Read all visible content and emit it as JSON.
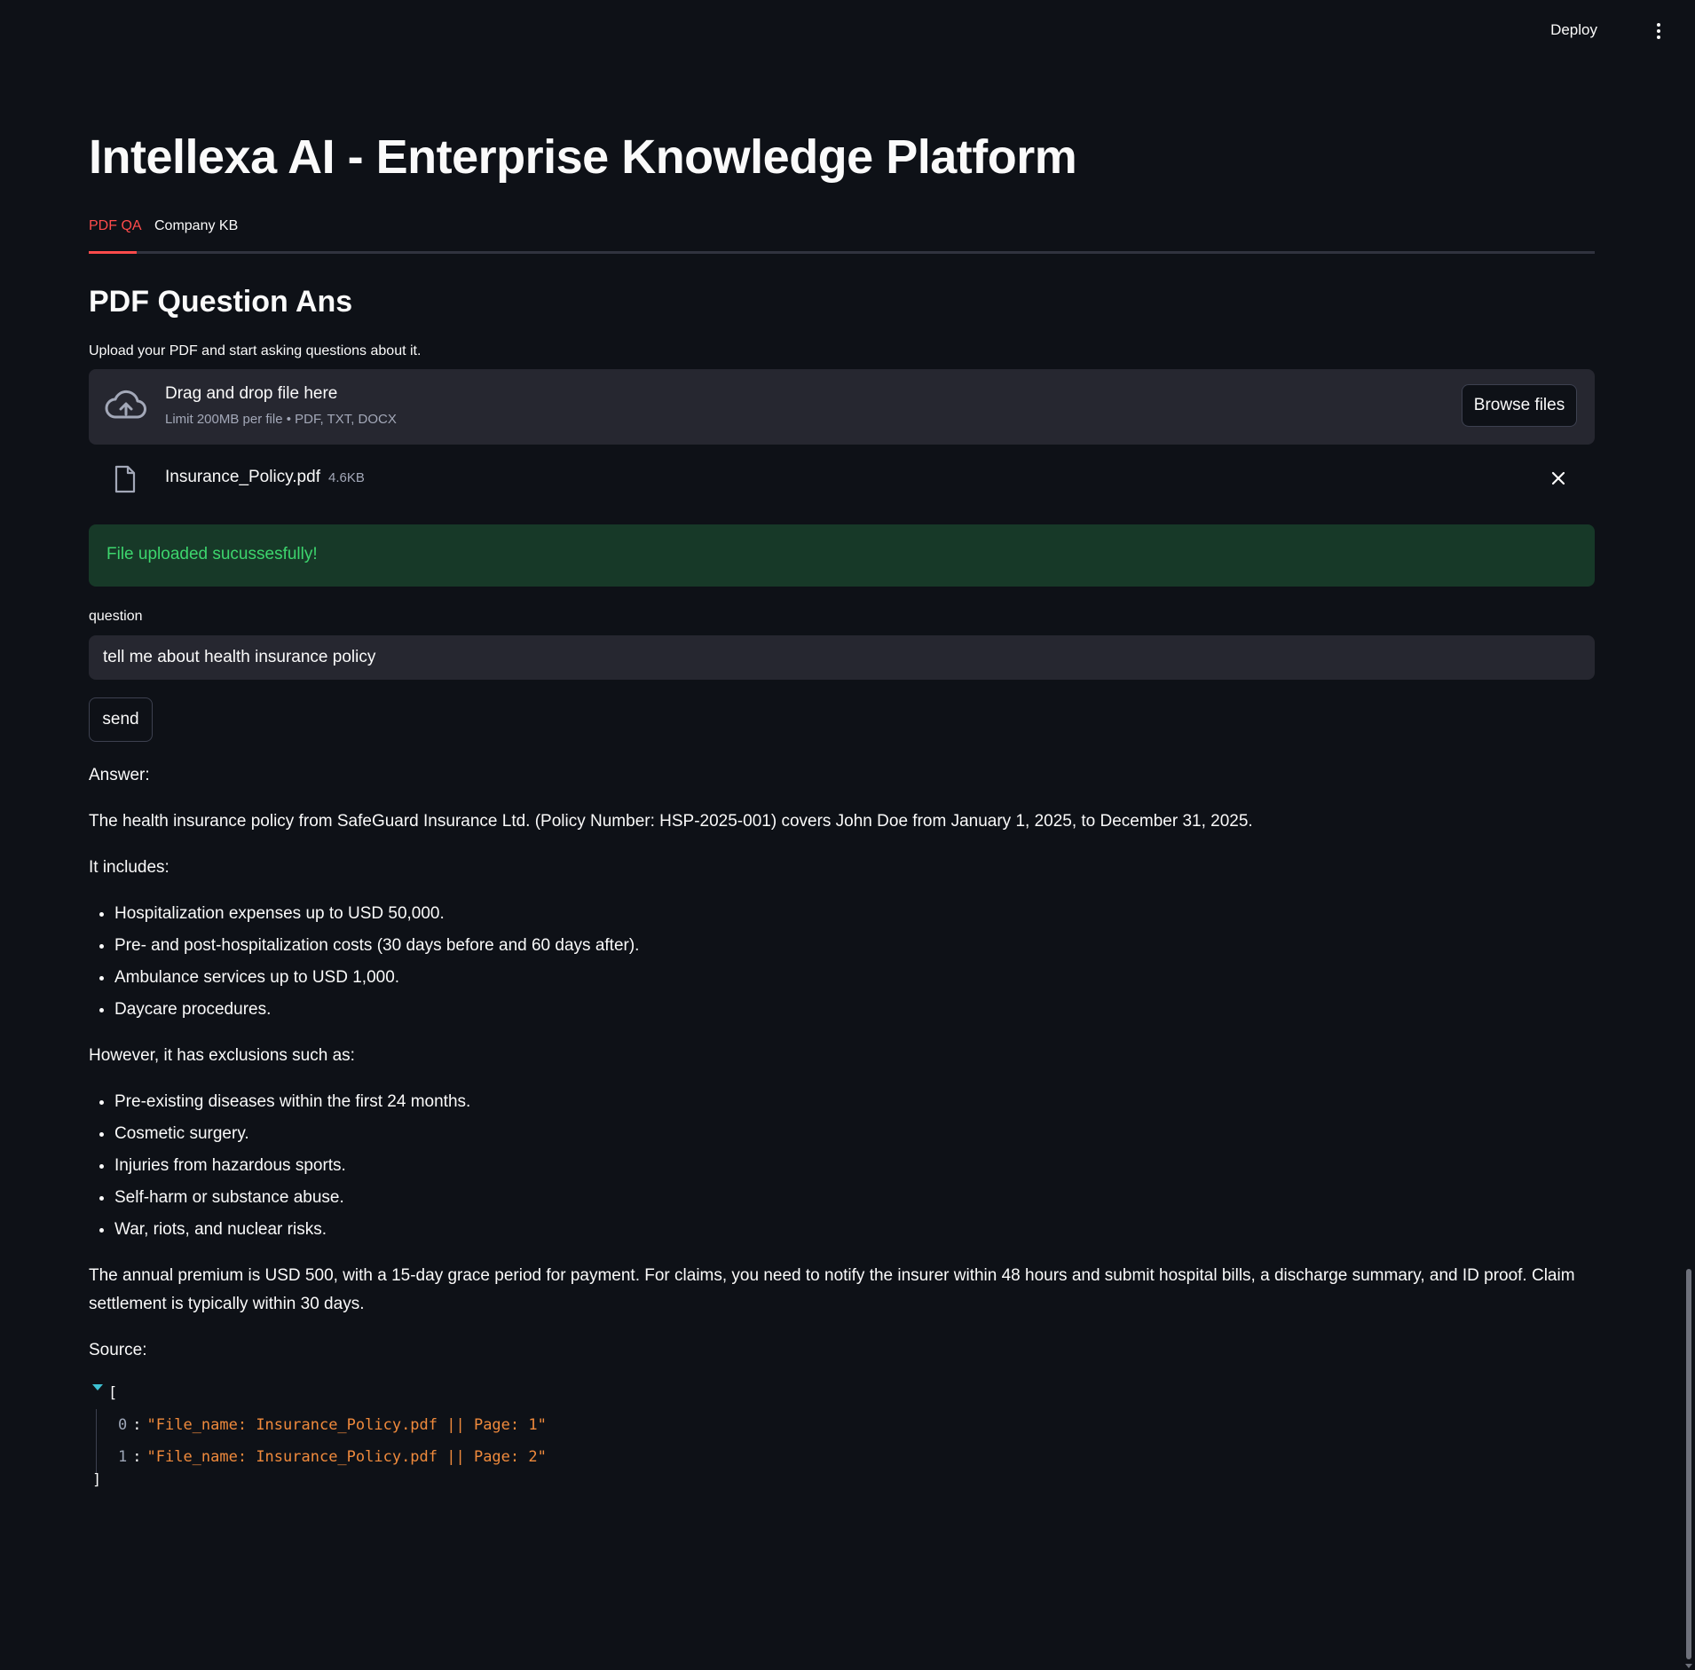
{
  "header": {
    "deploy_label": "Deploy",
    "menu_icon": "vertical-dots-icon"
  },
  "page": {
    "title": "Intellexa AI - Enterprise Knowledge Platform"
  },
  "tabs": [
    {
      "label": "PDF QA",
      "active": true
    },
    {
      "label": "Company KB",
      "active": false
    }
  ],
  "section": {
    "heading": "PDF Question Ans",
    "upload_instruction": "Upload your PDF and start asking questions about it."
  },
  "uploader": {
    "icon": "cloud-upload-icon",
    "title": "Drag and drop file here",
    "subtitle": "Limit 200MB per file • PDF, TXT, DOCX",
    "browse_label": "Browse files"
  },
  "uploaded_file": {
    "icon": "file-icon",
    "name": "Insurance_Policy.pdf",
    "size": "4.6KB"
  },
  "alert": {
    "message": "File uploaded sucussesfully!",
    "color": "#3dd56d"
  },
  "question": {
    "label": "question",
    "value": "tell me about health insurance policy",
    "send_label": "send"
  },
  "answer": {
    "label": "Answer:",
    "intro": "The health insurance policy from SafeGuard Insurance Ltd. (Policy Number: HSP-2025-001) covers John Doe from January 1, 2025, to December 31, 2025.",
    "includes_heading": "It includes:",
    "includes": [
      "Hospitalization expenses up to USD 50,000.",
      "Pre- and post-hospitalization costs (30 days before and 60 days after).",
      "Ambulance services up to USD 1,000.",
      "Daycare procedures."
    ],
    "exclusions_heading": "However, it has exclusions such as:",
    "exclusions": [
      "Pre-existing diseases within the first 24 months.",
      "Cosmetic surgery.",
      "Injuries from hazardous sports.",
      "Self-harm or substance abuse.",
      "War, riots, and nuclear risks."
    ],
    "closing": "The annual premium is USD 500, with a 15-day grace period for payment. For claims, you need to notify the insurer within 48 hours and submit hospital bills, a discharge summary, and ID proof. Claim settlement is typically within 30 days.",
    "source_label": "Source:"
  },
  "sources": {
    "open_bracket": "[",
    "close_bracket": "]",
    "items": [
      {
        "index": "0",
        "value": "\"File_name: Insurance_Policy.pdf || Page: 1\""
      },
      {
        "index": "1",
        "value": "\"File_name: Insurance_Policy.pdf || Page: 2\""
      }
    ]
  },
  "colors": {
    "background": "#0e1117",
    "accent": "#ff4b4b",
    "success_bg": "#173928",
    "json_string": "#f08a3c"
  }
}
